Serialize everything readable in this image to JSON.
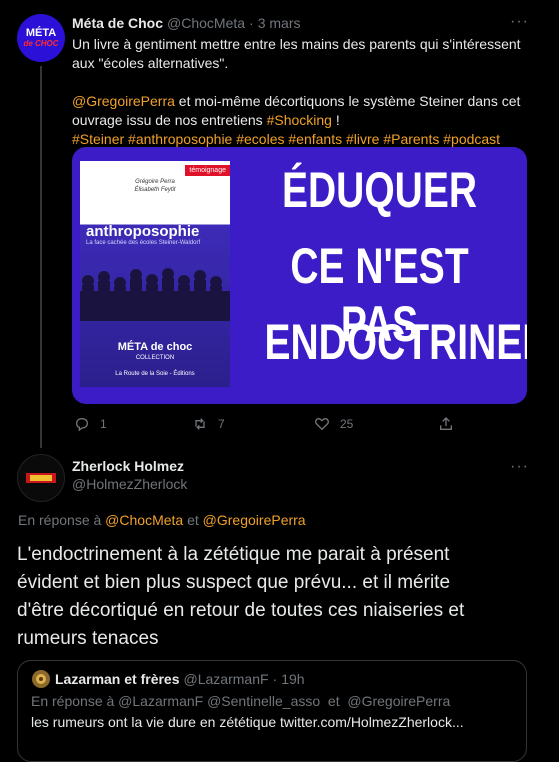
{
  "tweet1": {
    "name": "Méta de Choc",
    "handle": "@ChocMeta",
    "sep": "·",
    "time": "3 mars",
    "more": "···",
    "line1": "Un livre à gentiment mettre entre les mains des parents qui s'intéressent",
    "line2": "aux \"écoles alternatives\".",
    "mention1": "@GregoirePerra",
    "line3_rest": " et moi-même décortiquons le système Steiner dans cet",
    "line4_start": "ouvrage issu de nos entretiens ",
    "hashtag_shocking": "#Shocking",
    "line4_end": " !",
    "hashtags": "#Steiner #anthroposophie #ecoles #enfants #livre #Parents #podcast",
    "avatar_text": "MÉTA",
    "avatar_sub": "de CHOC",
    "media": {
      "book_tag": "témoignage",
      "book_authors_1": "Grégoire Perra",
      "book_authors_2": "Élisabeth Feytit",
      "book_title_1": "Une vie en",
      "book_title_2": "anthroposophie",
      "book_subtitle": "La face cachée des écoles Steiner-Waldorf",
      "book_logo": "MÉTA de choc",
      "book_collection": "COLLECTION",
      "book_publisher": "La Route de la Soie - Éditions",
      "banner_1": "ÉDUQUER",
      "banner_2": "CE N'EST PAS",
      "banner_3": "ENDOCTRINER"
    },
    "replies": "1",
    "retweets": "7",
    "likes": "25"
  },
  "tweet2": {
    "name": "Zherlock Holmez",
    "handle": "@HolmezZherlock",
    "more": "···",
    "reply_prefix": "En réponse à ",
    "reply_to_1": "@ChocMeta",
    "reply_and": " et ",
    "reply_to_2": "@GregoirePerra",
    "body_1": "L'endoctrinement à la zététique me parait à présent",
    "body_2": "évident et bien plus suspect que prévu... et il mérite",
    "body_3": "d'être décortiqué en retour de toutes ces niaiseries et",
    "body_4": "rumeurs tenaces"
  },
  "quote": {
    "name": "Lazarman et frères",
    "handle": "@LazarmanF",
    "sep": "·",
    "time": "19h",
    "reply_line": "En réponse à @LazarmanF @Sentinelle_asso  et  @GregoirePerra",
    "text": "les rumeurs ont la vie dure en zététique twitter.com/HolmezZherlock..."
  }
}
